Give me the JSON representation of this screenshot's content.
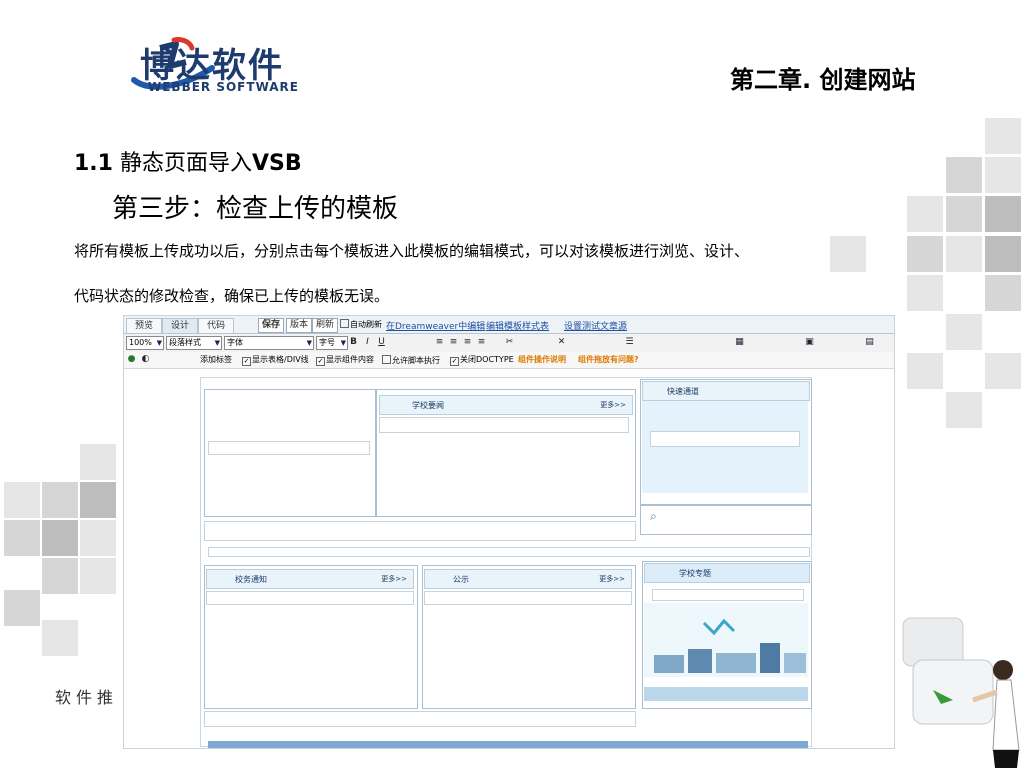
{
  "brand": {
    "name_cn": "博达软件",
    "name_en": "WEBBER SOFTWARE"
  },
  "chapter": "第二章. 创建网站",
  "section": {
    "number": "1.1",
    "title": "静态页面导入",
    "suffix": "VSB"
  },
  "step": "第三步：检查上传的模板",
  "description": [
    "将所有模板上传成功以后，分别点击每个模板进入此模板的编辑模式，可以对该模板进行浏览、设计、",
    "代码状态的修改检查，确保已上传的模板无误。"
  ],
  "footer_text": "软件推",
  "screenshot": {
    "tabs": [
      "预览",
      "设计",
      "代码"
    ],
    "active_tab": "设计",
    "buttons": {
      "save": "保存",
      "version": "版本",
      "refresh": "刷新"
    },
    "auto_refresh": "自动刷新",
    "links": [
      "在Dreamweaver中编辑",
      "编辑模板样式表",
      "设置测试文章源"
    ],
    "zoom": "100%",
    "paragraph_style": "段落样式",
    "font": "字体",
    "font_size": "字号",
    "format_icons": [
      "B",
      "I",
      "U"
    ],
    "options": {
      "add_tag": "添加标签",
      "show_table_div": "显示表格/DIV线",
      "show_component_content": "显示组件内容",
      "allow_script": "允许脚本执行",
      "close_doctype": "关闭DOCTYPE",
      "component_help": "组件操作说明",
      "component_question": "组件拖放有问题?"
    },
    "panels": {
      "school_news": "学校要闻",
      "quick_access": "快速通道",
      "affairs_notice": "校务通知",
      "public_notice": "公示",
      "school_topic": "学校专题",
      "more": "更多>>"
    }
  }
}
